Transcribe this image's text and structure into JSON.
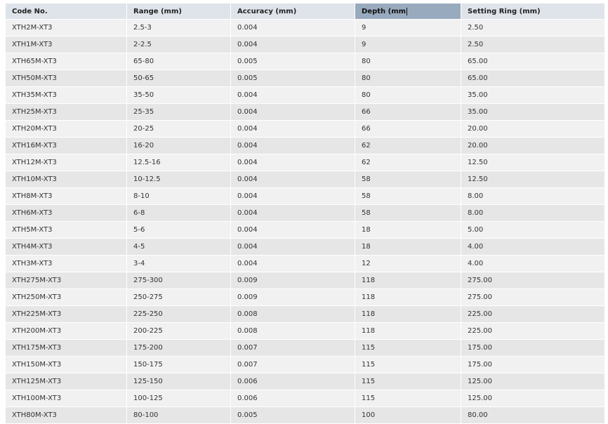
{
  "table": {
    "headers": [
      "Code No.",
      "Range (mm)",
      "Accuracy (mm)",
      "Depth (mm",
      "Setting Ring (mm)"
    ],
    "rows": [
      [
        "XTH2M-XT3",
        "2.5-3",
        "0.004",
        "9",
        "2.50"
      ],
      [
        "XTH1M-XT3",
        "2-2.5",
        "0.004",
        "9",
        "2.50"
      ],
      [
        "XTH65M-XT3",
        "65-80",
        "0.005",
        "80",
        "65.00"
      ],
      [
        "XTH50M-XT3",
        "50-65",
        "0.005",
        "80",
        "65.00"
      ],
      [
        "XTH35M-XT3",
        "35-50",
        "0.004",
        "80",
        "35.00"
      ],
      [
        "XTH25M-XT3",
        "25-35",
        "0.004",
        "66",
        "35.00"
      ],
      [
        "XTH20M-XT3",
        "20-25",
        "0.004",
        "66",
        "20.00"
      ],
      [
        "XTH16M-XT3",
        "16-20",
        "0.004",
        "62",
        "20.00"
      ],
      [
        "XTH12M-XT3",
        "12.5-16",
        "0.004",
        "62",
        "12.50"
      ],
      [
        "XTH10M-XT3",
        "10-12.5",
        "0.004",
        "58",
        "12.50"
      ],
      [
        "XTH8M-XT3",
        "8-10",
        "0.004",
        "58",
        "8.00"
      ],
      [
        "XTH6M-XT3",
        "6-8",
        "0.004",
        "58",
        "8.00"
      ],
      [
        "XTH5M-XT3",
        "5-6",
        "0.004",
        "18",
        "5.00"
      ],
      [
        "XTH4M-XT3",
        "4-5",
        "0.004",
        "18",
        "4.00"
      ],
      [
        "XTH3M-XT3",
        "3-4",
        "0.004",
        "12",
        "4.00"
      ],
      [
        "XTH275M-XT3",
        "275-300",
        "0.009",
        "118",
        "275.00"
      ],
      [
        "XTH250M-XT3",
        "250-275",
        "0.009",
        "118",
        "275.00"
      ],
      [
        "XTH225M-XT3",
        "225-250",
        "0.008",
        "118",
        "225.00"
      ],
      [
        "XTH200M-XT3",
        "200-225",
        "0.008",
        "118",
        "225.00"
      ],
      [
        "XTH175M-XT3",
        "175-200",
        "0.007",
        "115",
        "175.00"
      ],
      [
        "XTH150M-XT3",
        "150-175",
        "0.007",
        "115",
        "175.00"
      ],
      [
        "XTH125M-XT3",
        "125-150",
        "0.006",
        "115",
        "125.00"
      ],
      [
        "XTH100M-XT3",
        "100-125",
        "0.006",
        "115",
        "125.00"
      ],
      [
        "XTH80M-XT3",
        "80-100",
        "0.005",
        "100",
        "80.00"
      ]
    ],
    "sorted_column": 3,
    "colors": {
      "header_bg": "#dfe3ea",
      "sorted_header_bg": "#98aabd",
      "row_odd": "#f1f1f1",
      "row_even": "#e6e6e6"
    }
  }
}
